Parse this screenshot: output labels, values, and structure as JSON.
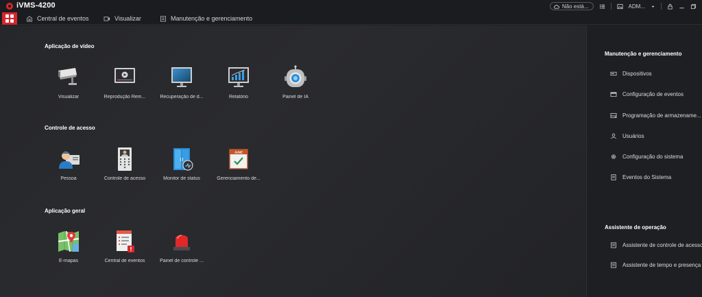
{
  "app": {
    "title": "iVMS-4200"
  },
  "titlebar": {
    "cloud_status": "Não está...",
    "user": "ADM...",
    "icons": [
      "cloud-icon",
      "user-list-icon",
      "image-icon",
      "dropdown-icon",
      "lock-icon",
      "minimize-icon",
      "restore-icon"
    ]
  },
  "menubar": {
    "items": [
      {
        "label": "Central de eventos",
        "icon": "event-center-icon"
      },
      {
        "label": "Visualizar",
        "icon": "live-view-icon"
      },
      {
        "label": "Manutenção e gerenciamento",
        "icon": "maintenance-icon"
      }
    ]
  },
  "sections": [
    {
      "title": "Aplicação de vídeo",
      "tiles": [
        {
          "label": "Visualizar",
          "icon": "camera-icon"
        },
        {
          "label": "Reprodução Rem...",
          "icon": "playback-icon"
        },
        {
          "label": "Recuperação de d...",
          "icon": "monitor-icon"
        },
        {
          "label": "Relatório",
          "icon": "report-chart-icon"
        },
        {
          "label": "Painel de IA",
          "icon": "ai-robot-icon"
        }
      ]
    },
    {
      "title": "Controle de acesso",
      "tiles": [
        {
          "label": "Pessoa",
          "icon": "person-card-icon"
        },
        {
          "label": "Controle de acesso",
          "icon": "door-panel-icon"
        },
        {
          "label": "Monitor de status",
          "icon": "door-status-icon"
        },
        {
          "label": "Gerenciamento de...",
          "icon": "calendar-icon"
        }
      ]
    },
    {
      "title": "Aplicação geral",
      "tiles": [
        {
          "label": "E-mapas",
          "icon": "map-pin-icon"
        },
        {
          "label": "Central de eventos",
          "icon": "event-list-icon"
        },
        {
          "label": "Painel de controle ...",
          "icon": "alarm-light-icon"
        }
      ]
    }
  ],
  "right_panel": {
    "maintenance": {
      "title": "Manutenção e gerenciamento",
      "items": [
        {
          "label": "Dispositivos",
          "icon": "device-icon"
        },
        {
          "label": "Configuração de eventos",
          "icon": "event-config-icon"
        },
        {
          "label": "Programação de armazename...",
          "icon": "storage-schedule-icon"
        },
        {
          "label": "Usuários",
          "icon": "user-icon"
        },
        {
          "label": "Configuração do sistema",
          "icon": "gear-icon"
        },
        {
          "label": "Eventos do Sistema",
          "icon": "system-log-icon"
        }
      ]
    },
    "assistant": {
      "title": "Assistente de operação",
      "items": [
        {
          "label": "Assistente de controle de acesso",
          "icon": "assistant-access-icon"
        },
        {
          "label": "Assistente de tempo e presença",
          "icon": "assistant-attendance-icon"
        }
      ]
    }
  },
  "colors": {
    "brand": "#d7262c",
    "background": "#1e1f22",
    "accent_blue": "#2a8fd8"
  }
}
